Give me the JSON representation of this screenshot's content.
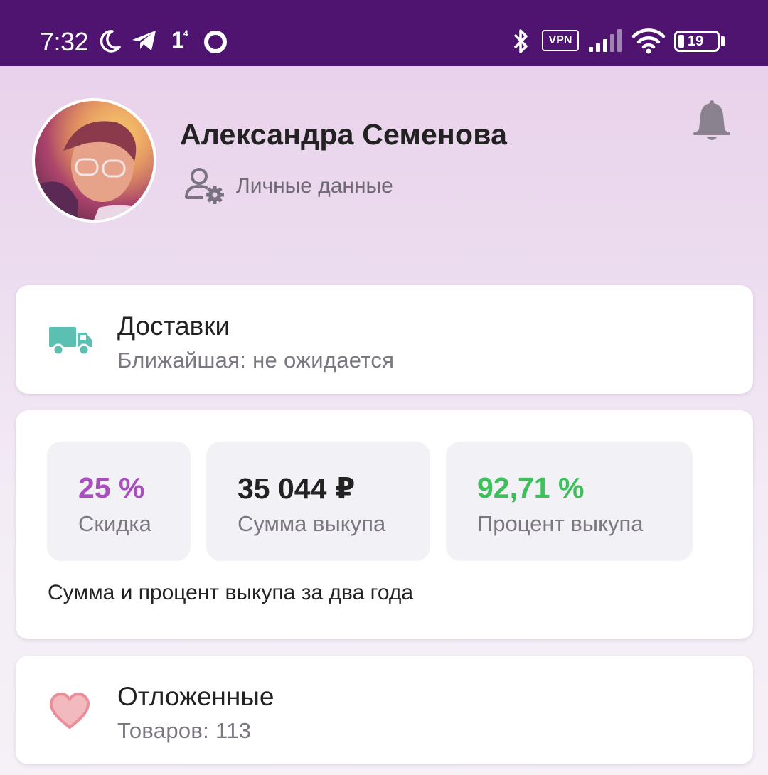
{
  "status_bar": {
    "time": "7:32",
    "notif_count": "1",
    "notif_sup": "4",
    "vpn": "VPN",
    "battery": "19",
    "icons": [
      "moon-icon",
      "telegram-icon",
      "circle-icon",
      "bluetooth-icon",
      "signal-icon",
      "wifi-icon",
      "battery-icon"
    ]
  },
  "profile": {
    "name": "Александра Семенова",
    "personal_data_label": "Личные данные"
  },
  "deliveries": {
    "title": "Доставки",
    "subtitle": "Ближайшая: не ожидается",
    "icon": "truck-icon",
    "icon_color": "#5bbfb2"
  },
  "stats": {
    "discount": {
      "value": "25 %",
      "label": "Скидка",
      "color": "#a94dbf"
    },
    "purchase_sum": {
      "value": "35 044 ₽",
      "label": "Сумма выкупа",
      "color": "#222222"
    },
    "purchase_percent": {
      "value": "92,71 %",
      "label": "Процент выкупа",
      "color": "#3cc15a"
    },
    "note": "Сумма и процент выкупа за два года"
  },
  "favorites": {
    "title": "Отложенные",
    "subtitle": "Товаров: 113",
    "icon": "heart-icon",
    "icon_color": "#f2a6ae"
  },
  "colors": {
    "status_bar_bg": "#4e1470",
    "header_bg": "#e8cfea"
  }
}
